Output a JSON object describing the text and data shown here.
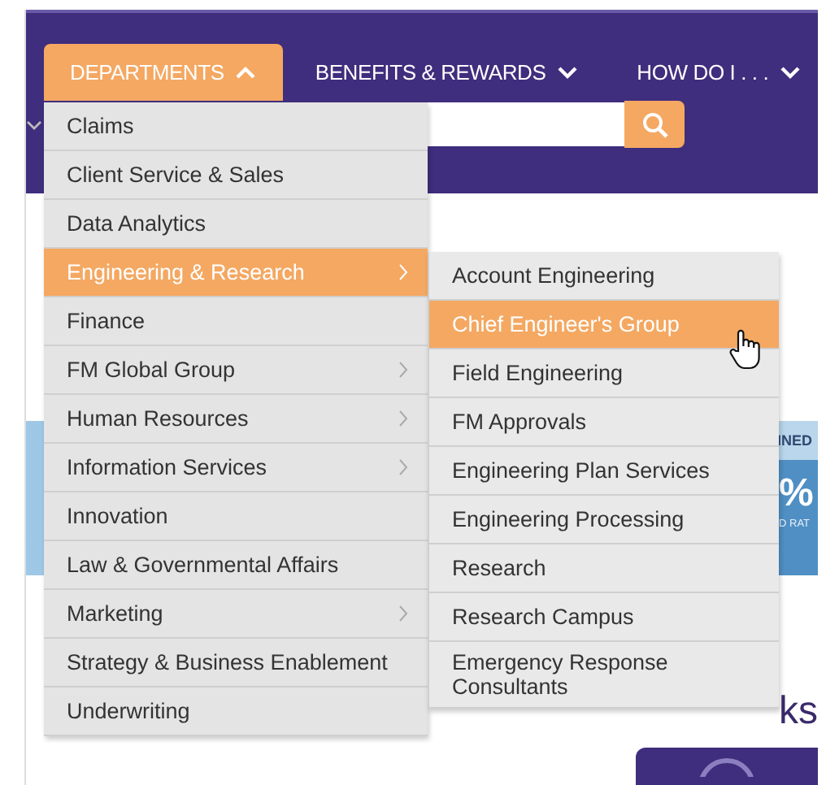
{
  "nav": {
    "tabs": [
      {
        "label": "DEPARTMENTS",
        "selected": true,
        "expanded": true
      },
      {
        "label": "BENEFITS & REWARDS",
        "selected": false,
        "expanded": false
      },
      {
        "label": "HOW DO I . . .",
        "selected": false,
        "expanded": false
      }
    ]
  },
  "departments_menu": {
    "items": [
      {
        "label": "Claims",
        "selected": false,
        "has_submenu": false
      },
      {
        "label": "Client Service & Sales",
        "selected": false,
        "has_submenu": false
      },
      {
        "label": "Data Analytics",
        "selected": false,
        "has_submenu": false
      },
      {
        "label": "Engineering & Research",
        "selected": true,
        "has_submenu": true
      },
      {
        "label": "Finance",
        "selected": false,
        "has_submenu": false
      },
      {
        "label": "FM Global Group",
        "selected": false,
        "has_submenu": true
      },
      {
        "label": "Human Resources",
        "selected": false,
        "has_submenu": true
      },
      {
        "label": "Information Services",
        "selected": false,
        "has_submenu": true
      },
      {
        "label": "Innovation",
        "selected": false,
        "has_submenu": false
      },
      {
        "label": "Law & Governmental Affairs",
        "selected": false,
        "has_submenu": false
      },
      {
        "label": "Marketing",
        "selected": false,
        "has_submenu": true
      },
      {
        "label": "Strategy & Business Enablement",
        "selected": false,
        "has_submenu": false
      },
      {
        "label": "Underwriting",
        "selected": false,
        "has_submenu": false
      }
    ]
  },
  "submenu": {
    "items": [
      {
        "label": "Account Engineering",
        "selected": false
      },
      {
        "label": "Chief Engineer's Group",
        "selected": true
      },
      {
        "label": "Field Engineering",
        "selected": false
      },
      {
        "label": "FM Approvals",
        "selected": false
      },
      {
        "label": "Engineering Plan Services",
        "selected": false
      },
      {
        "label": "Engineering Processing",
        "selected": false
      },
      {
        "label": "Research",
        "selected": false
      },
      {
        "label": "Research Campus",
        "selected": false
      },
      {
        "label": "Emergency Response Consultants",
        "selected": false
      }
    ]
  },
  "banner": {
    "heading_fragment": "INED",
    "value_fragment": "%",
    "caption_fragment": "D RAT"
  },
  "section_heading_fragment": "ks"
}
